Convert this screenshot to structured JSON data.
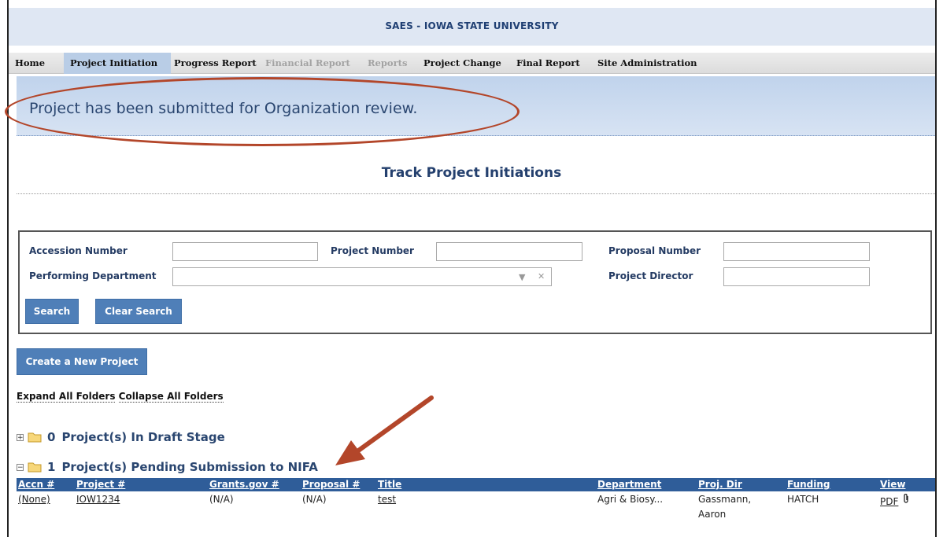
{
  "header": {
    "title": "SAES - IOWA STATE UNIVERSITY"
  },
  "nav": {
    "items": [
      {
        "label": "Home"
      },
      {
        "label": "Project Initiation"
      },
      {
        "label": "Progress Report"
      },
      {
        "label": "Financial Report"
      },
      {
        "label": "Reports"
      },
      {
        "label": "Project Change"
      },
      {
        "label": "Final Report"
      },
      {
        "label": "Site Administration"
      }
    ]
  },
  "banner": {
    "message": "Project has been submitted for Organization review."
  },
  "page_title": "Track Project Initiations",
  "search": {
    "accession_label": "Accession Number",
    "project_number_label": "Project Number",
    "proposal_number_label": "Proposal Number",
    "department_label": "Performing Department",
    "director_label": "Project Director",
    "search_button": "Search",
    "clear_button": "Clear Search"
  },
  "create_button": "Create a New Project",
  "folder_links": {
    "expand": "Expand All Folders",
    "collapse": "Collapse All Folders"
  },
  "folders": [
    {
      "toggle": "+",
      "count": "0",
      "label": "Project(s) In Draft Stage"
    },
    {
      "toggle": "−",
      "count": "1",
      "label": "Project(s) Pending Submission to NIFA"
    }
  ],
  "table": {
    "headers": [
      "Accn #",
      "Project #",
      "Grants.gov #",
      "Proposal #",
      "Title",
      "Department",
      "Proj. Dir",
      "Funding",
      "View"
    ],
    "rows": [
      {
        "accn": "(None)",
        "project": "IOW1234",
        "grants": "(N/A)",
        "proposal": "(N/A)",
        "title": "test",
        "department": "Agri & Biosy...",
        "director_last": "Gassmann,",
        "director_first": "Aaron",
        "funding": "HATCH",
        "view": "PDF"
      }
    ]
  },
  "colors": {
    "header_bg": "#dfe7f3",
    "accent": "#2f5d99",
    "button": "#4f7fb8",
    "annotation": "#b3462a"
  }
}
